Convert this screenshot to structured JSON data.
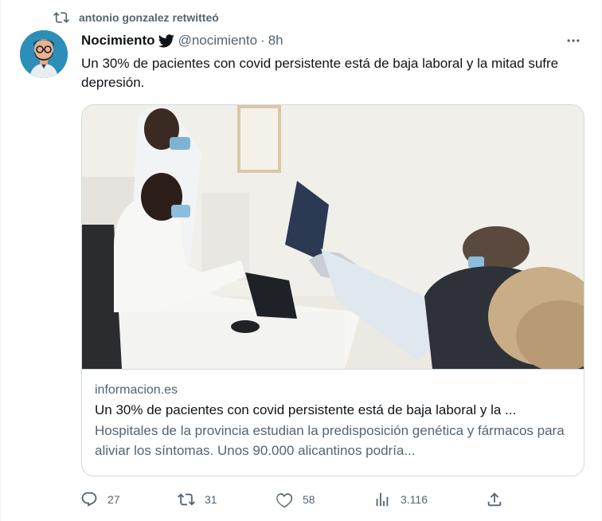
{
  "retweet": {
    "icon": "retweet-icon",
    "text": "antonio gonzalez retwitteó"
  },
  "author": {
    "name": "Nocimiento",
    "handle": "@nocimiento",
    "separator": "·",
    "time": "8h",
    "verified_icon": "twitter-bird-icon"
  },
  "tweet": {
    "text": "Un 30% de pacientes con covid persistente está de baja laboral y la mitad sufre depresión."
  },
  "link_card": {
    "domain": "informacion.es",
    "title": "Un 30% de pacientes con covid persistente está de baja laboral y la ...",
    "description": "Hospitales de la provincia estudian la predisposición genética y fármacos para aliviar los síntomas. Unos 90.000 alicantinos podría..."
  },
  "actions": {
    "replies": "27",
    "retweets": "31",
    "likes": "58",
    "views": "3.116"
  },
  "colors": {
    "text": "#0f1419",
    "secondary": "#536471",
    "border": "#cfd9de"
  }
}
